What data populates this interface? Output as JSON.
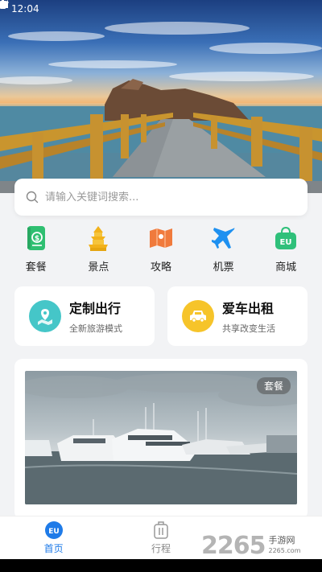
{
  "status_bar": {
    "time": "12:04"
  },
  "search": {
    "placeholder": "请输入关键词搜索..."
  },
  "categories": [
    {
      "label": "套餐",
      "icon": "package-icon",
      "color": "#2fbf71"
    },
    {
      "label": "景点",
      "icon": "pagoda-icon",
      "color": "#f2b21b"
    },
    {
      "label": "攻略",
      "icon": "map-icon",
      "color": "#f07a3c"
    },
    {
      "label": "机票",
      "icon": "airplane-icon",
      "color": "#1e90f0"
    },
    {
      "label": "商城",
      "icon": "shopping-bag-icon",
      "color": "#2fc07a"
    }
  ],
  "features": [
    {
      "title": "定制出行",
      "subtitle": "全新旅游模式",
      "icon": "map-pin-icon",
      "color": "#45c6c8"
    },
    {
      "title": "爱车出租",
      "subtitle": "共享改变生活",
      "icon": "car-icon",
      "color": "#f6c42a"
    }
  ],
  "package_card": {
    "tag": "套餐"
  },
  "bottom_nav": [
    {
      "label": "首页",
      "active": true
    },
    {
      "label": "行程",
      "active": false
    }
  ],
  "watermark": {
    "number": "2265",
    "name": "手游网",
    "url": "2265.com"
  },
  "colors": {
    "accent": "#1f7be8",
    "background": "#f2f3f5"
  }
}
